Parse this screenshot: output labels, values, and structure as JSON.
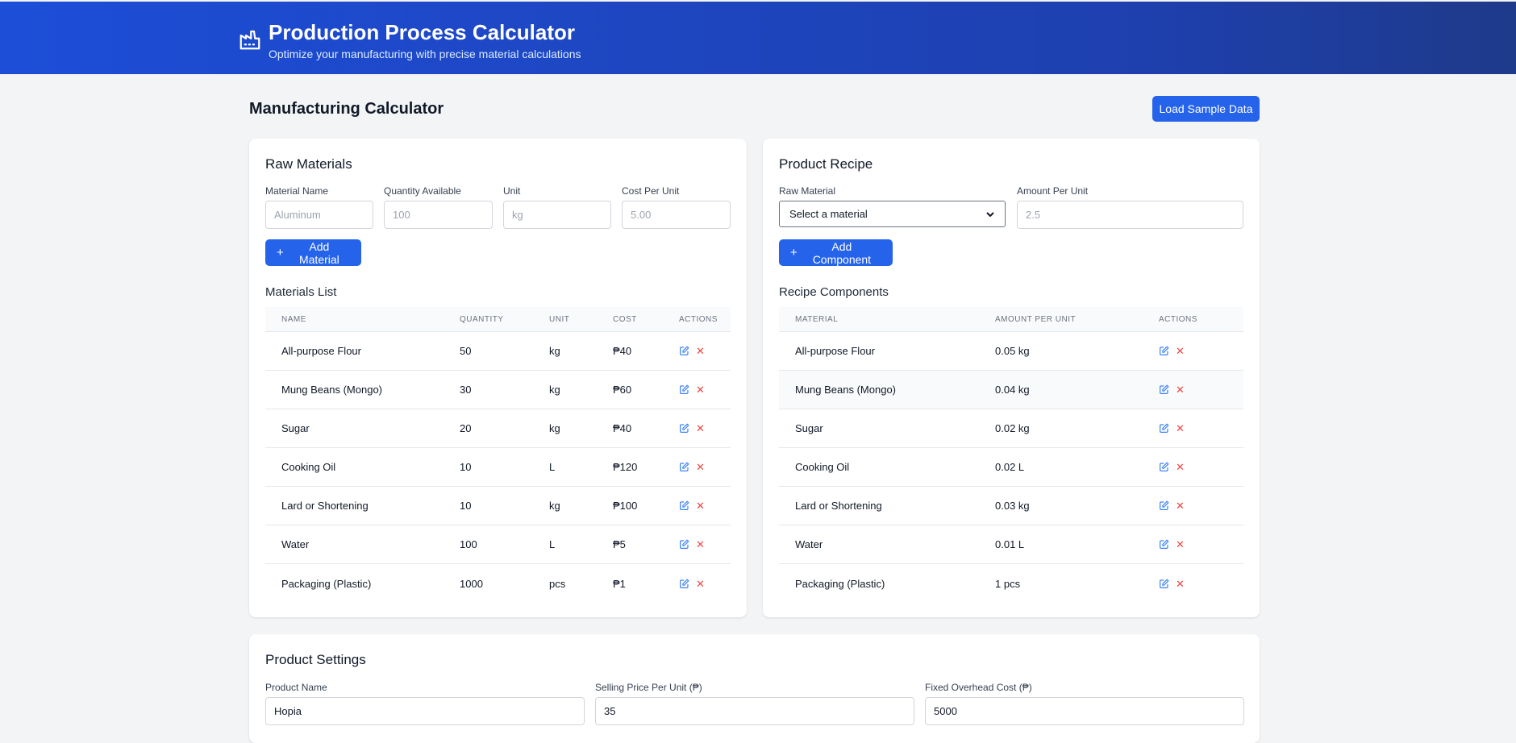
{
  "header": {
    "title": "Production Process Calculator",
    "subtitle": "Optimize your manufacturing with precise material calculations"
  },
  "page": {
    "title": "Manufacturing Calculator",
    "sample_button": "Load Sample Data"
  },
  "raw_materials": {
    "title": "Raw Materials",
    "fields": {
      "name_label": "Material Name",
      "name_placeholder": "Aluminum",
      "qty_label": "Quantity Available",
      "qty_placeholder": "100",
      "unit_label": "Unit",
      "unit_placeholder": "kg",
      "cost_label": "Cost Per Unit",
      "cost_placeholder": "5.00"
    },
    "add_button": "Add Material",
    "list_title": "Materials List",
    "columns": [
      "NAME",
      "QUANTITY",
      "UNIT",
      "COST",
      "ACTIONS"
    ],
    "rows": [
      {
        "name": "All-purpose Flour",
        "quantity": "50",
        "unit": "kg",
        "cost": "₱40"
      },
      {
        "name": "Mung Beans (Mongo)",
        "quantity": "30",
        "unit": "kg",
        "cost": "₱60"
      },
      {
        "name": "Sugar",
        "quantity": "20",
        "unit": "kg",
        "cost": "₱40"
      },
      {
        "name": "Cooking Oil",
        "quantity": "10",
        "unit": "L",
        "cost": "₱120"
      },
      {
        "name": "Lard or Shortening",
        "quantity": "10",
        "unit": "kg",
        "cost": "₱100"
      },
      {
        "name": "Water",
        "quantity": "100",
        "unit": "L",
        "cost": "₱5"
      },
      {
        "name": "Packaging (Plastic)",
        "quantity": "1000",
        "unit": "pcs",
        "cost": "₱1"
      }
    ]
  },
  "recipe": {
    "title": "Product Recipe",
    "material_label": "Raw Material",
    "material_selected": "Select a material",
    "amount_label": "Amount Per Unit",
    "amount_placeholder": "2.5",
    "add_button": "Add Component",
    "list_title": "Recipe Components",
    "columns": [
      "MATERIAL",
      "AMOUNT PER UNIT",
      "ACTIONS"
    ],
    "rows": [
      {
        "material": "All-purpose Flour",
        "amount": "0.05 kg"
      },
      {
        "material": "Mung Beans (Mongo)",
        "amount": "0.04 kg"
      },
      {
        "material": "Sugar",
        "amount": "0.02 kg"
      },
      {
        "material": "Cooking Oil",
        "amount": "0.02 L"
      },
      {
        "material": "Lard or Shortening",
        "amount": "0.03 kg"
      },
      {
        "material": "Water",
        "amount": "0.01 L"
      },
      {
        "material": "Packaging (Plastic)",
        "amount": "1 pcs"
      }
    ]
  },
  "settings": {
    "title": "Product Settings",
    "product_name_label": "Product Name",
    "product_name_value": "Hopia",
    "price_label": "Selling Price Per Unit (₱)",
    "price_value": "35",
    "overhead_label": "Fixed Overhead Cost (₱)",
    "overhead_value": "5000"
  },
  "colors": {
    "primary": "#2563eb",
    "header_start": "#1d4ed8",
    "header_end": "#1e3a8a",
    "delete": "#ef4444"
  },
  "icons": {
    "logo": "factory-icon",
    "edit": "edit-icon",
    "delete": "close-icon"
  }
}
